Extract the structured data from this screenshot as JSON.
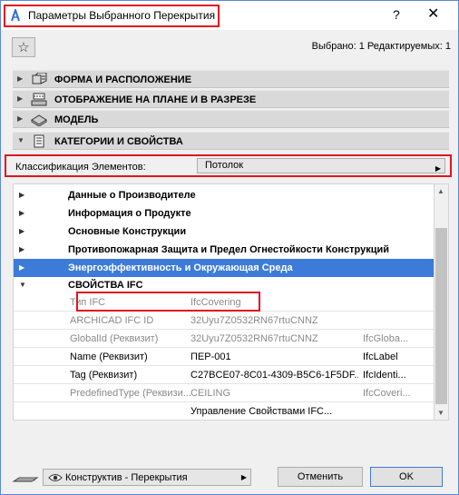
{
  "window": {
    "title": "Параметры Выбранного Перекрытия",
    "help": "?",
    "close": "✕"
  },
  "toolbar": {
    "selected_info": "Выбрано: 1 Редактируемых: 1"
  },
  "sections": [
    {
      "label": "ФОРМА И РАСПОЛОЖЕНИЕ",
      "icon": "shape-position-icon",
      "expanded": false
    },
    {
      "label": "ОТОБРАЖЕНИЕ НА ПЛАНЕ И В РАЗРЕЗЕ",
      "icon": "floor-plan-icon",
      "expanded": false
    },
    {
      "label": "МОДЕЛЬ",
      "icon": "model-icon",
      "expanded": false
    },
    {
      "label": "КАТЕГОРИИ И СВОЙСТВА",
      "icon": "categories-icon",
      "expanded": true
    }
  ],
  "classification": {
    "label": "Классификация Элементов:",
    "value": "Потолок"
  },
  "tree": {
    "groups": [
      {
        "label": "Данные о Производителе"
      },
      {
        "label": "Информация о Продукте"
      },
      {
        "label": "Основные Конструкции"
      },
      {
        "label": "Противопожарная Защита и Предел Огнестойкости Конструкций"
      },
      {
        "label": "Энергоэффективность и Окружающая Среда"
      }
    ],
    "ifc_group": {
      "label": "СВОЙСТВА IFC"
    },
    "properties": [
      {
        "name": "Тип IFC",
        "value": "IfcCovering",
        "type": ""
      },
      {
        "name": "ARCHICAD IFC ID",
        "value": "32Uyu7Z0532RN67rtuCNNZ",
        "type": ""
      },
      {
        "name": "GlobalId (Реквизит)",
        "value": "32Uyu7Z0532RN67rtuCNNZ",
        "type": "IfcGloba..."
      },
      {
        "name": "Name (Реквизит)",
        "value": "ПЕР-001",
        "type": "IfcLabel"
      },
      {
        "name": "Tag (Реквизит)",
        "value": "C27BCE07-8C01-4309-B5C6-1F5DF...",
        "type": "IfcIdenti..."
      },
      {
        "name": "PredefinedType (Реквизи...",
        "value": "CEILING",
        "type": "IfcCoveri..."
      }
    ],
    "manage_label": "Управление Свойствами IFC..."
  },
  "footer": {
    "view_value": "Конструктив - Перекрытия",
    "cancel": "Отменить",
    "ok": "OK"
  }
}
